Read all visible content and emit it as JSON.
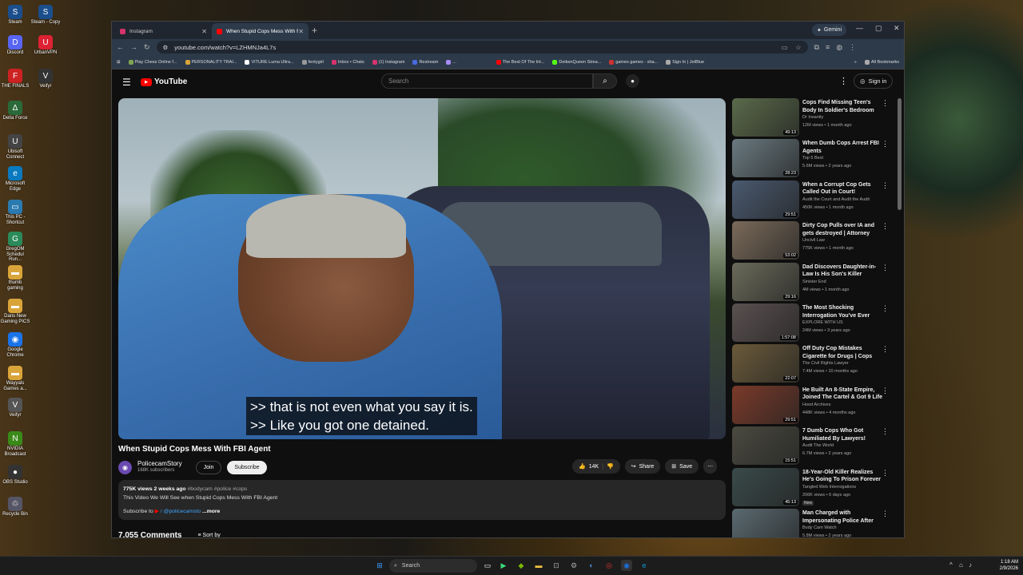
{
  "desktop": {
    "icons": [
      {
        "label": "Steam",
        "glyph": "S",
        "color": "#1b4e8c"
      },
      {
        "label": "Steam - Copy",
        "glyph": "S",
        "color": "#1b4e8c"
      },
      {
        "label": "Discord",
        "glyph": "D",
        "color": "#5865f2"
      },
      {
        "label": "UrbanVPN",
        "glyph": "U",
        "color": "#d23"
      },
      {
        "label": "THE FINALS",
        "glyph": "F",
        "color": "#c22"
      },
      {
        "label": "Veifyr",
        "glyph": "V",
        "color": "#333"
      },
      {
        "label": "Delta Force",
        "glyph": "Δ",
        "color": "#2a6a3a"
      },
      {
        "label": "Ubisoft Connect",
        "glyph": "U",
        "color": "#444"
      },
      {
        "label": "Microsoft Edge",
        "glyph": "e",
        "color": "#0a7ac0"
      },
      {
        "label": "This PC - Shortcut",
        "glyph": "▭",
        "color": "#2a7ab0"
      },
      {
        "label": "GregOM Schedul Run...",
        "glyph": "G",
        "color": "#2a8a5a"
      },
      {
        "label": "thumb gaming",
        "glyph": "▬",
        "color": "#d9a53a"
      },
      {
        "label": "Dans New Gaming PICS",
        "glyph": "▬",
        "color": "#d9a53a"
      },
      {
        "label": "Google Chrome",
        "glyph": "◉",
        "color": "#1a73e8"
      },
      {
        "label": "Wayyals Games a...",
        "glyph": "▬",
        "color": "#d9a53a"
      },
      {
        "label": "Veifyr",
        "glyph": "V",
        "color": "#555"
      },
      {
        "label": "NVIDIA Broadcast",
        "glyph": "N",
        "color": "#3a8a1a"
      },
      {
        "label": "OBS Studio",
        "glyph": "●",
        "color": "#333"
      },
      {
        "label": "Recycle Bin",
        "glyph": "♲",
        "color": "#556"
      }
    ]
  },
  "browser": {
    "tabs": [
      {
        "title": "Instagram",
        "color": "#d6336c"
      },
      {
        "title": "When Stupid Cops Mess With F",
        "color": "#f00"
      }
    ],
    "gemini_label": "Gemini",
    "url": "youtube.com/watch?v=LZHMNJa4L7s",
    "bookmarks": [
      {
        "label": "Play Chess Online f...",
        "color": "#7fa650"
      },
      {
        "label": "PERSONALITY TRAI...",
        "color": "#d9a53a"
      },
      {
        "label": "VITURE Luma Ultra...",
        "color": "#fff"
      },
      {
        "label": "fentygirl",
        "color": "#999"
      },
      {
        "label": "Inbox • Chats",
        "color": "#d6336c"
      },
      {
        "label": "(1) Instagram",
        "color": "#d6336c"
      },
      {
        "label": "Restream",
        "color": "#4a6ae0"
      },
      {
        "label": "...",
        "color": "#a78bfa"
      },
      {
        "label": "The Best Of The Int...",
        "color": "#f00"
      },
      {
        "label": "DeikenQueen Strea...",
        "color": "#53fc18"
      },
      {
        "label": "games games - sha...",
        "color": "#c33"
      },
      {
        "label": "Sign In | JetBlue",
        "color": "#aaa"
      }
    ],
    "all_bookmarks": "All Bookmarks"
  },
  "youtube": {
    "logo": "YouTube",
    "search_placeholder": "Search",
    "sign_in": "Sign in",
    "caption_lines": [
      ">> that is not even what you say it is.",
      ">> Like you got one detained."
    ],
    "video_title": "When Stupid Cops Mess With FBI Agent",
    "channel_name": "PolicecamStory",
    "subscribers": "168K subscribers",
    "join": "Join",
    "subscribe": "Subscribe",
    "likes": "14K",
    "share": "Share",
    "save": "Save",
    "views_date": "775K views  2 weeks ago",
    "hashtags": "#bodycam #police #cops",
    "description": "This Video We Will See when Stupid Cops Mess With FBI Agent",
    "subscribe_to": "Subscribe to",
    "channel_handle": "/ @policecamsto",
    "more": "...more",
    "comments_count": "7,055 Comments",
    "sort_by": "Sort by"
  },
  "recommendations": [
    {
      "title": "Cops Find Missing Teen's Body In Soldier's Bedroom",
      "channel": "Dr Insanity",
      "meta": "12M views • 1 month ago",
      "duration": "49:13",
      "thumb": "#5a6a4a",
      "badge": ""
    },
    {
      "title": "When Dumb Cops Arrest FBI Agents",
      "channel": "Top 5 Best",
      "meta": "5.6M views • 2 years ago",
      "duration": "28:23",
      "thumb": "#6a7a80",
      "badge": ""
    },
    {
      "title": "When a Corrupt Cop Gets Called Out in Court!",
      "channel": "Audit the Court and Audit the Audit",
      "meta": "450K views • 1 month ago",
      "duration": "29:51",
      "thumb": "#4a5a70",
      "badge": ""
    },
    {
      "title": "Dirty Cop Pulls over IA and gets destroyed | Attorney Reacts",
      "channel": "Uncivil Law",
      "meta": "775K views • 1 month ago",
      "duration": "53:02",
      "thumb": "#7a6a5a",
      "badge": ""
    },
    {
      "title": "Dad Discovers Daughter-in-Law Is His Son's Killer",
      "channel": "Sinister End",
      "meta": "4M views • 1 month ago",
      "duration": "29:16",
      "thumb": "#6a6a5a",
      "badge": ""
    },
    {
      "title": "The Most Shocking Interrogation You've Ever Seen...",
      "channel": "EXPLORE WITH US",
      "meta": "24M views • 3 years ago",
      "duration": "1:57:08",
      "thumb": "#5a5050",
      "badge": ""
    },
    {
      "title": "Off Duty Cop Mistakes Cigarette for Drugs | Cops Tear Apart Hi...",
      "channel": "The Civil Rights Lawyer",
      "meta": "7.4M views • 10 months ago",
      "duration": "22:07",
      "thumb": "#6a5a3a",
      "badge": ""
    },
    {
      "title": "He Built An 8-State Empire, Joined The Cartel & Got 9 Life ...",
      "channel": "Hood Archives",
      "meta": "448K views • 4 months ago",
      "duration": "29:51",
      "thumb": "#7a3a2a",
      "badge": ""
    },
    {
      "title": "7 Dumb Cops Who Got Humiliated By Lawyers!",
      "channel": "Audit The World",
      "meta": "6.7M views • 2 years ago",
      "duration": "15:51",
      "thumb": "#4a4a40",
      "badge": ""
    },
    {
      "title": "18-Year-Old Killer Realizes He's Going To Prison Forever",
      "channel": "Tangled Web Interrogations",
      "meta": "206K views • 6 days ago",
      "duration": "45:13",
      "thumb": "#3a4a4a",
      "badge": "New"
    },
    {
      "title": "Man Charged with Impersonating Police After He...",
      "channel": "Body Cam Watch",
      "meta": "5.8M views • 2 years ago",
      "duration": "",
      "thumb": "#5a6a70",
      "badge": ""
    }
  ],
  "taskbar": {
    "search": "Search",
    "time": "1:18 AM",
    "date": "2/9/2026"
  }
}
